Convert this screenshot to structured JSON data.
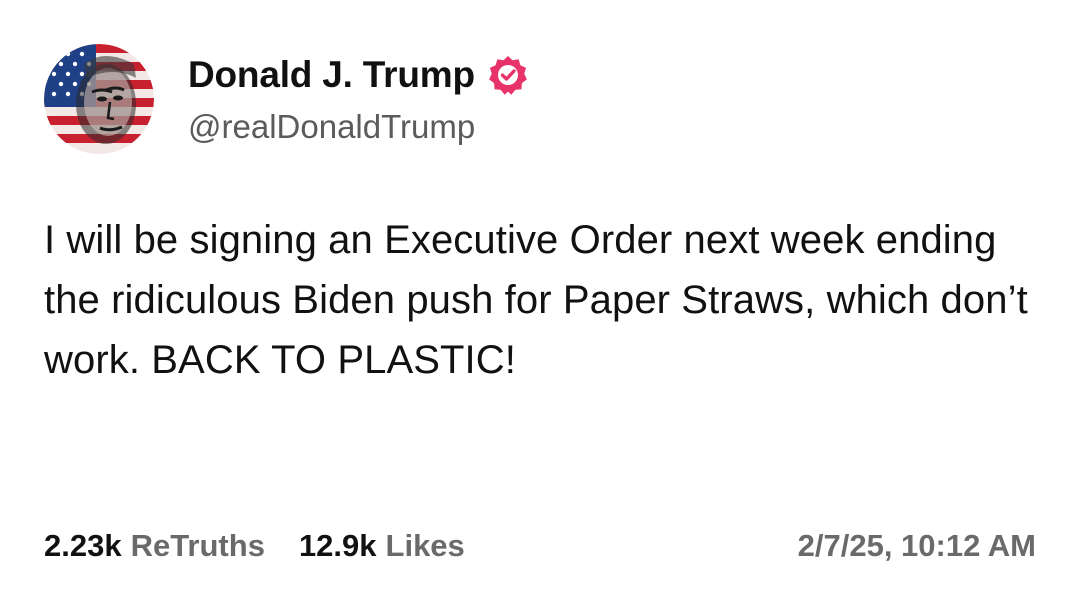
{
  "author": {
    "display_name": "Donald J. Trump",
    "handle": "@realDonaldTrump",
    "verified_badge_icon": "verified-check-badge",
    "avatar_icon": "flag-portrait-avatar"
  },
  "post": {
    "text": "I will be signing an Executive Order next week ending the ridiculous Biden push for Paper Straws, which don’t work. BACK TO PLASTIC!"
  },
  "stats": {
    "retruths_count": "2.23k",
    "retruths_label": "ReTruths",
    "likes_count": "12.9k",
    "likes_label": "Likes"
  },
  "timestamp": "2/7/25, 10:12 AM",
  "colors": {
    "badge": "#e8336a",
    "text_primary": "#111111",
    "text_secondary": "#6a6a6a"
  }
}
